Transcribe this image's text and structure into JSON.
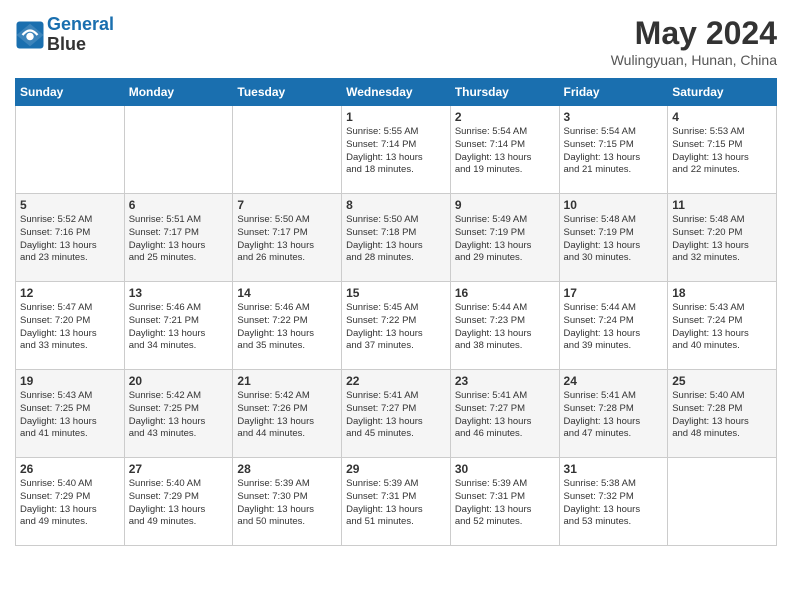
{
  "header": {
    "logo_line1": "General",
    "logo_line2": "Blue",
    "month": "May 2024",
    "location": "Wulingyuan, Hunan, China"
  },
  "days_of_week": [
    "Sunday",
    "Monday",
    "Tuesday",
    "Wednesday",
    "Thursday",
    "Friday",
    "Saturday"
  ],
  "weeks": [
    [
      {
        "day": "",
        "info": ""
      },
      {
        "day": "",
        "info": ""
      },
      {
        "day": "",
        "info": ""
      },
      {
        "day": "1",
        "info": "Sunrise: 5:55 AM\nSunset: 7:14 PM\nDaylight: 13 hours\nand 18 minutes."
      },
      {
        "day": "2",
        "info": "Sunrise: 5:54 AM\nSunset: 7:14 PM\nDaylight: 13 hours\nand 19 minutes."
      },
      {
        "day": "3",
        "info": "Sunrise: 5:54 AM\nSunset: 7:15 PM\nDaylight: 13 hours\nand 21 minutes."
      },
      {
        "day": "4",
        "info": "Sunrise: 5:53 AM\nSunset: 7:15 PM\nDaylight: 13 hours\nand 22 minutes."
      }
    ],
    [
      {
        "day": "5",
        "info": "Sunrise: 5:52 AM\nSunset: 7:16 PM\nDaylight: 13 hours\nand 23 minutes."
      },
      {
        "day": "6",
        "info": "Sunrise: 5:51 AM\nSunset: 7:17 PM\nDaylight: 13 hours\nand 25 minutes."
      },
      {
        "day": "7",
        "info": "Sunrise: 5:50 AM\nSunset: 7:17 PM\nDaylight: 13 hours\nand 26 minutes."
      },
      {
        "day": "8",
        "info": "Sunrise: 5:50 AM\nSunset: 7:18 PM\nDaylight: 13 hours\nand 28 minutes."
      },
      {
        "day": "9",
        "info": "Sunrise: 5:49 AM\nSunset: 7:19 PM\nDaylight: 13 hours\nand 29 minutes."
      },
      {
        "day": "10",
        "info": "Sunrise: 5:48 AM\nSunset: 7:19 PM\nDaylight: 13 hours\nand 30 minutes."
      },
      {
        "day": "11",
        "info": "Sunrise: 5:48 AM\nSunset: 7:20 PM\nDaylight: 13 hours\nand 32 minutes."
      }
    ],
    [
      {
        "day": "12",
        "info": "Sunrise: 5:47 AM\nSunset: 7:20 PM\nDaylight: 13 hours\nand 33 minutes."
      },
      {
        "day": "13",
        "info": "Sunrise: 5:46 AM\nSunset: 7:21 PM\nDaylight: 13 hours\nand 34 minutes."
      },
      {
        "day": "14",
        "info": "Sunrise: 5:46 AM\nSunset: 7:22 PM\nDaylight: 13 hours\nand 35 minutes."
      },
      {
        "day": "15",
        "info": "Sunrise: 5:45 AM\nSunset: 7:22 PM\nDaylight: 13 hours\nand 37 minutes."
      },
      {
        "day": "16",
        "info": "Sunrise: 5:44 AM\nSunset: 7:23 PM\nDaylight: 13 hours\nand 38 minutes."
      },
      {
        "day": "17",
        "info": "Sunrise: 5:44 AM\nSunset: 7:24 PM\nDaylight: 13 hours\nand 39 minutes."
      },
      {
        "day": "18",
        "info": "Sunrise: 5:43 AM\nSunset: 7:24 PM\nDaylight: 13 hours\nand 40 minutes."
      }
    ],
    [
      {
        "day": "19",
        "info": "Sunrise: 5:43 AM\nSunset: 7:25 PM\nDaylight: 13 hours\nand 41 minutes."
      },
      {
        "day": "20",
        "info": "Sunrise: 5:42 AM\nSunset: 7:25 PM\nDaylight: 13 hours\nand 43 minutes."
      },
      {
        "day": "21",
        "info": "Sunrise: 5:42 AM\nSunset: 7:26 PM\nDaylight: 13 hours\nand 44 minutes."
      },
      {
        "day": "22",
        "info": "Sunrise: 5:41 AM\nSunset: 7:27 PM\nDaylight: 13 hours\nand 45 minutes."
      },
      {
        "day": "23",
        "info": "Sunrise: 5:41 AM\nSunset: 7:27 PM\nDaylight: 13 hours\nand 46 minutes."
      },
      {
        "day": "24",
        "info": "Sunrise: 5:41 AM\nSunset: 7:28 PM\nDaylight: 13 hours\nand 47 minutes."
      },
      {
        "day": "25",
        "info": "Sunrise: 5:40 AM\nSunset: 7:28 PM\nDaylight: 13 hours\nand 48 minutes."
      }
    ],
    [
      {
        "day": "26",
        "info": "Sunrise: 5:40 AM\nSunset: 7:29 PM\nDaylight: 13 hours\nand 49 minutes."
      },
      {
        "day": "27",
        "info": "Sunrise: 5:40 AM\nSunset: 7:29 PM\nDaylight: 13 hours\nand 49 minutes."
      },
      {
        "day": "28",
        "info": "Sunrise: 5:39 AM\nSunset: 7:30 PM\nDaylight: 13 hours\nand 50 minutes."
      },
      {
        "day": "29",
        "info": "Sunrise: 5:39 AM\nSunset: 7:31 PM\nDaylight: 13 hours\nand 51 minutes."
      },
      {
        "day": "30",
        "info": "Sunrise: 5:39 AM\nSunset: 7:31 PM\nDaylight: 13 hours\nand 52 minutes."
      },
      {
        "day": "31",
        "info": "Sunrise: 5:38 AM\nSunset: 7:32 PM\nDaylight: 13 hours\nand 53 minutes."
      },
      {
        "day": "",
        "info": ""
      }
    ]
  ]
}
